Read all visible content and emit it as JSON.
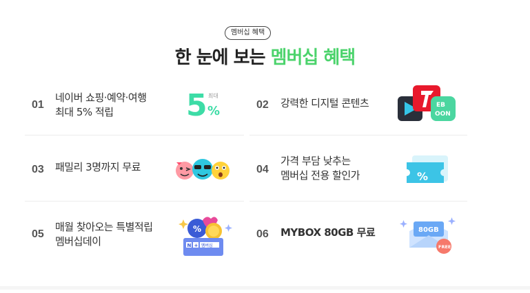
{
  "header": {
    "badge": "멤버십 혜택",
    "title_prefix": "한 눈에 보는 ",
    "title_accent": "멤버십 혜택"
  },
  "benefits": [
    {
      "num": "01",
      "line1": "네이버 쇼핑·예약·여행",
      "line2": "최대 5% 적립",
      "icon": "five-percent-icon",
      "icon_text_big": "5",
      "icon_text_small": "최대",
      "icon_text_pct": "%"
    },
    {
      "num": "02",
      "line1": "강력한 디지털 콘텐츠",
      "line2": "",
      "icon": "digital-content-icon",
      "icon_text": "EB\nOON"
    },
    {
      "num": "03",
      "line1": "패밀리 3명까지 무료",
      "line2": "",
      "icon": "family-emoji-icon"
    },
    {
      "num": "04",
      "line1": "가격 부담 낮추는",
      "line2": "멤버십 전용 할인가",
      "icon": "discount-coupon-icon",
      "icon_text": "%"
    },
    {
      "num": "05",
      "line1": "매월 찾아오는 특별적립",
      "line2": "멤버십데이",
      "icon": "membership-day-icon",
      "icon_text": "멤버십"
    },
    {
      "num": "06",
      "line1": "MYBOX 80GB 무료",
      "line2": "",
      "icon": "mybox-cloud-icon",
      "icon_text": "80GB",
      "icon_badge": "FREE"
    }
  ],
  "colors": {
    "accent": "#4cd36c",
    "text": "#333333"
  }
}
